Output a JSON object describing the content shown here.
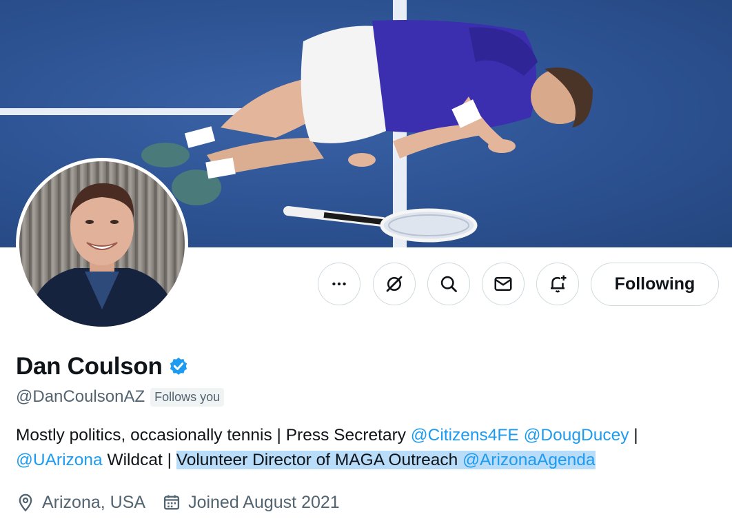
{
  "profile": {
    "display_name": "Dan Coulson",
    "verified_icon": "verified-badge-icon",
    "handle": "@DanCoulsonAZ",
    "follows_you": "Follows you",
    "bio": {
      "t1": "Mostly politics, occasionally tennis | Press Secretary ",
      "m1": "@Citizens4FE",
      "t2": " ",
      "m2": "@DougDucey",
      "t3": " |",
      "m3": "@UArizona",
      "t4": " Wildcat | ",
      "h1": "Volunteer Director of MAGA Outreach ",
      "m4": "@ArizonaAgenda"
    },
    "location": "Arizona, USA",
    "joined": "Joined August 2021"
  },
  "actions": {
    "more_icon": "more-icon",
    "grok_icon": "grok-icon",
    "search_icon": "search-icon",
    "message_icon": "message-icon",
    "notify_icon": "bell-plus-icon",
    "following_label": "Following"
  },
  "colors": {
    "link": "#1d9bf0",
    "secondary_text": "#536471",
    "highlight": "#b9dcf8",
    "border": "#cfd9de",
    "court_blue": "#2f5596"
  }
}
